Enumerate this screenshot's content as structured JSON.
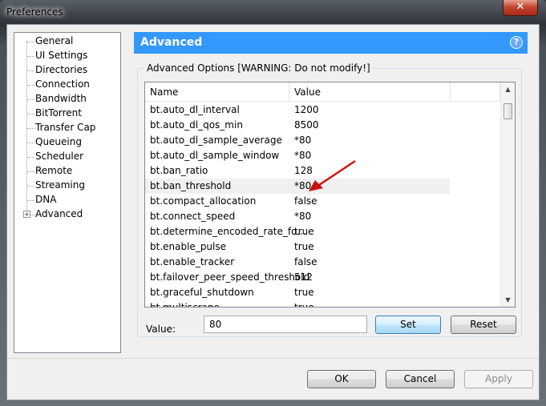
{
  "window": {
    "title": "Preferences",
    "close_icon": "close-icon"
  },
  "sidebar": {
    "items": [
      {
        "label": "General"
      },
      {
        "label": "UI Settings"
      },
      {
        "label": "Directories"
      },
      {
        "label": "Connection"
      },
      {
        "label": "Bandwidth"
      },
      {
        "label": "BitTorrent"
      },
      {
        "label": "Transfer Cap"
      },
      {
        "label": "Queueing"
      },
      {
        "label": "Scheduler"
      },
      {
        "label": "Remote"
      },
      {
        "label": "Streaming"
      },
      {
        "label": "DNA"
      },
      {
        "label": "Advanced",
        "expandable": true
      }
    ]
  },
  "header": {
    "title": "Advanced",
    "help": "?",
    "color": "#3399ff"
  },
  "group": {
    "label": "Advanced Options [WARNING: Do not modify!]"
  },
  "table": {
    "columns": [
      "Name",
      "Value"
    ],
    "selected_index": 5,
    "rows": [
      {
        "name": "bt.auto_dl_interval",
        "value": "1200"
      },
      {
        "name": "bt.auto_dl_qos_min",
        "value": "8500"
      },
      {
        "name": "bt.auto_dl_sample_average",
        "value": "*80"
      },
      {
        "name": "bt.auto_dl_sample_window",
        "value": "*80"
      },
      {
        "name": "bt.ban_ratio",
        "value": "128"
      },
      {
        "name": "bt.ban_threshold",
        "value": "*80"
      },
      {
        "name": "bt.compact_allocation",
        "value": "false"
      },
      {
        "name": "bt.connect_speed",
        "value": "*80"
      },
      {
        "name": "bt.determine_encoded_rate_fo...",
        "value": "true"
      },
      {
        "name": "bt.enable_pulse",
        "value": "true"
      },
      {
        "name": "bt.enable_tracker",
        "value": "false"
      },
      {
        "name": "bt.failover_peer_speed_threshold",
        "value": "512"
      },
      {
        "name": "bt.graceful_shutdown",
        "value": "true"
      },
      {
        "name": "bt.multiscrape",
        "value": "true"
      }
    ]
  },
  "value_editor": {
    "label": "Value:",
    "value": "80",
    "set": "Set",
    "reset": "Reset"
  },
  "footer": {
    "ok": "OK",
    "cancel": "Cancel",
    "apply": "Apply"
  },
  "annotation": {
    "arrow_color": "#cc1111"
  }
}
